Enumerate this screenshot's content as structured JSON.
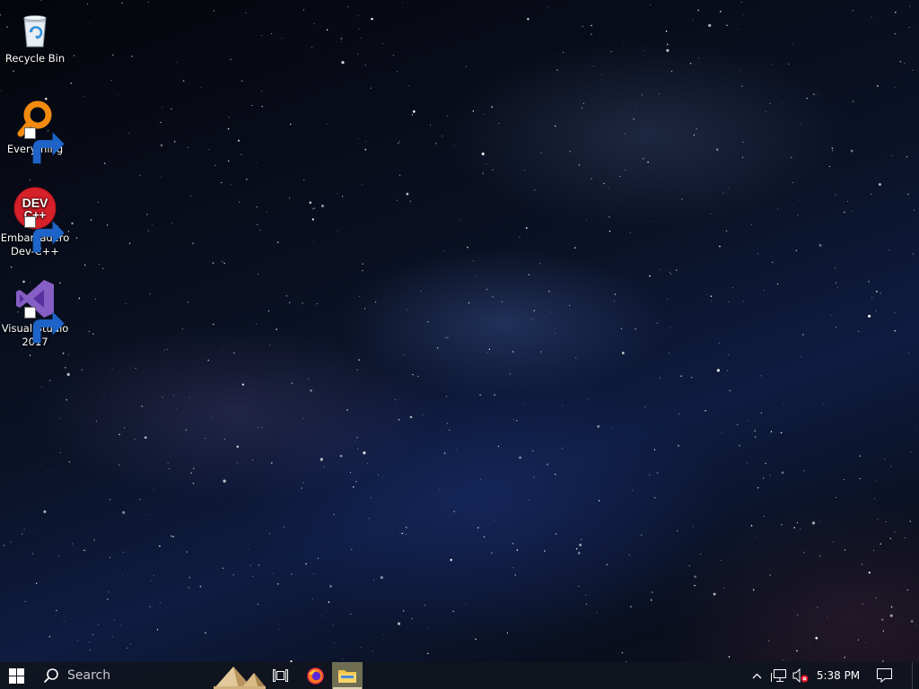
{
  "desktop": {
    "icons": [
      {
        "label": "Recycle Bin",
        "icon": "recycle-bin-icon",
        "shortcut": false
      },
      {
        "label": "Everything",
        "icon": "everything-search-icon",
        "shortcut": true
      },
      {
        "label": "Embarcadero\nDev-C++",
        "icon": "dev-cpp-icon",
        "shortcut": true,
        "badge_text": "DEV\nC++"
      },
      {
        "label": "Visual Studio\n2017",
        "icon": "visual-studio-icon",
        "shortcut": true
      }
    ],
    "wallpaper": "starry-night-milky-way"
  },
  "taskbar": {
    "start_icon": "windows-logo-icon",
    "search_placeholder": "Search",
    "pinned": [
      {
        "name": "task-view",
        "icon": "task-view-icon"
      },
      {
        "name": "firefox",
        "icon": "firefox-icon"
      },
      {
        "name": "file-explorer",
        "icon": "folder-icon",
        "active": true
      }
    ],
    "tray": {
      "chevron_icon": "chevron-up-icon",
      "network_icon": "network-disconnected-icon",
      "volume_icon": "volume-muted-icon",
      "time": "5:38 PM",
      "action_center_icon": "notification-icon"
    }
  },
  "colors": {
    "taskbar_bg": "#10141e",
    "active_app_highlight": "#6f6d52",
    "everything_orange": "#f28a10",
    "devcpp_red": "#d6202a",
    "visual_studio_purple": "#865fc5"
  }
}
